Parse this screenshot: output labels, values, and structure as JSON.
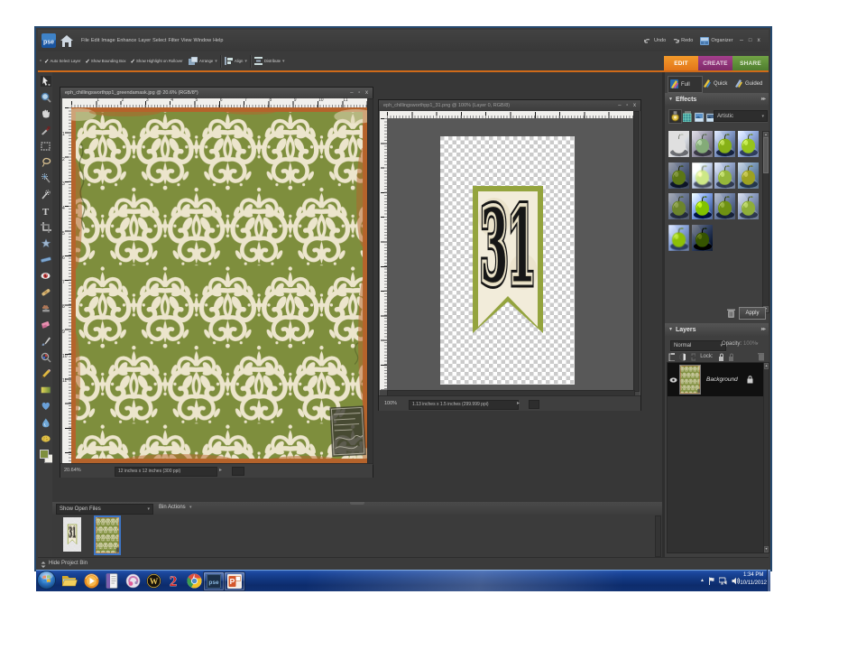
{
  "menubar": {
    "logo": "pse",
    "items": [
      "File",
      "Edit",
      "Image",
      "Enhance",
      "Layer",
      "Select",
      "Filter",
      "View",
      "Window",
      "Help"
    ],
    "undo": "Undo",
    "redo": "Redo",
    "organizer": "Organizer",
    "window_buttons": {
      "minimize": "–",
      "maximize": "□",
      "close": "x"
    }
  },
  "optionsbar": {
    "checkboxes": [
      "Auto Select Layer",
      "Show Bounding Box",
      "Show Highlight on Rollover"
    ],
    "buttons": [
      "Arrange",
      "Align",
      "Distribute"
    ]
  },
  "tabs": {
    "edit": "EDIT",
    "create": "CREATE",
    "share": "SHARE"
  },
  "modes": {
    "full": "Full",
    "quick": "Quick",
    "guided": "Guided"
  },
  "effects": {
    "title": "Effects",
    "category": "Artistic",
    "apply": "Apply",
    "thumb_count": 14
  },
  "layers": {
    "title": "Layers",
    "blend_mode": "Normal",
    "opacity_label": "Opacity:",
    "opacity_value": "100%",
    "lock_label": "Lock:",
    "layer_name": "Background"
  },
  "doc1": {
    "title": "eph_chillingsworthpp1_greendamask.jpg @ 20.6% (RGB/8*)",
    "zoom": "20.64%",
    "dims": "12 inches x 12 inches (300 ppi)",
    "ruler_numbers": [
      "1",
      "2",
      "3",
      "4",
      "5",
      "6",
      "7",
      "8",
      "9",
      "10",
      "11"
    ]
  },
  "doc2": {
    "title": "eph_chillingsworthpp1_31.png @ 100% (Layer 0, RGB/8)",
    "zoom": "100%",
    "dims": "1.13 inches x 1.5 inches (299.999 ppi)",
    "banner_number": "31"
  },
  "bin": {
    "show_open_files": "Show Open Files",
    "bin_actions": "Bin Actions",
    "hide": "Hide Project Bin"
  },
  "taskbar": {
    "clock_time": "1:34 PM",
    "clock_date": "10/11/2012"
  },
  "colors": {
    "accent_orange": "#cf6a19",
    "tab_create": "#9a3b84",
    "tab_share": "#5f923c",
    "damask_green": "#7e8e3d",
    "damask_cream": "#ece5cc",
    "banner_green": "#94a43e"
  }
}
